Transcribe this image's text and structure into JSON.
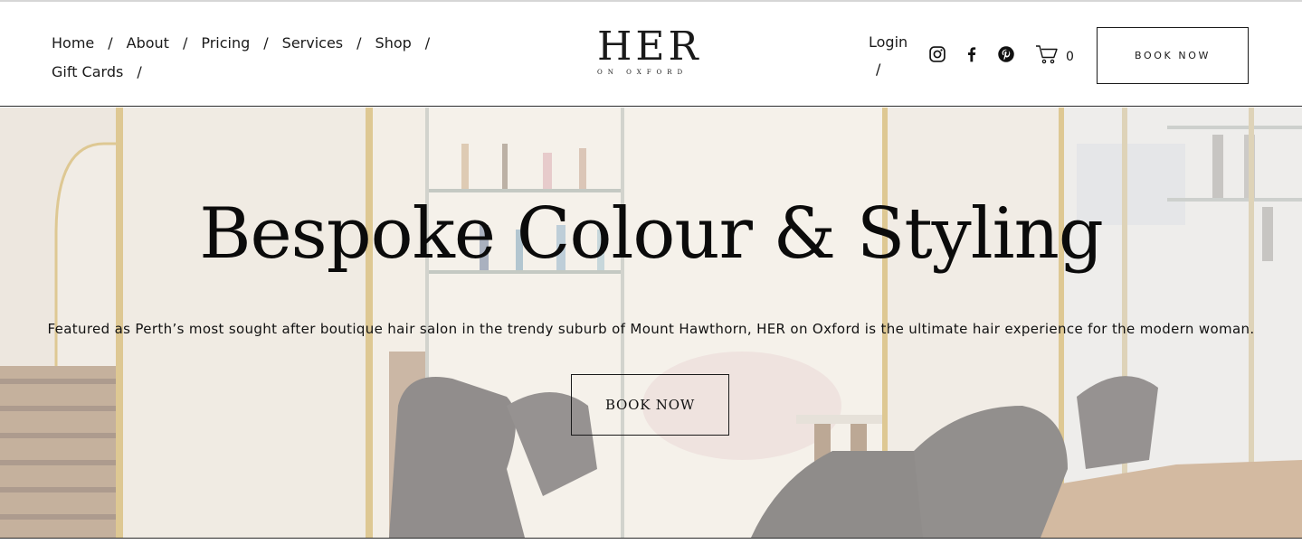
{
  "nav": {
    "items": [
      {
        "label": "Home"
      },
      {
        "label": "About"
      },
      {
        "label": "Pricing"
      },
      {
        "label": "Services"
      },
      {
        "label": "Shop"
      },
      {
        "label": "Gift Cards"
      }
    ],
    "separator": "/"
  },
  "logo": {
    "word": "HER",
    "sub": "ON OXFORD"
  },
  "account": {
    "login_label": "Login",
    "separator": "/"
  },
  "social": {
    "icons": [
      "instagram-icon",
      "facebook-icon",
      "pinterest-icon"
    ]
  },
  "cart": {
    "icon": "cart-icon",
    "count": "0"
  },
  "header_cta": {
    "label": "BOOK NOW"
  },
  "hero": {
    "title": "Bespoke Colour & Styling",
    "subtitle": "Featured as Perth’s most sought after boutique hair salon in the trendy suburb of Mount Hawthorn, HER on Oxford is the ultimate hair experience for the modern woman.",
    "cta_label": "BOOK NOW"
  },
  "colors": {
    "text": "#111111",
    "background": "#ffffff",
    "hero_tint": "#f1ece4",
    "brass": "#c9a44a"
  }
}
